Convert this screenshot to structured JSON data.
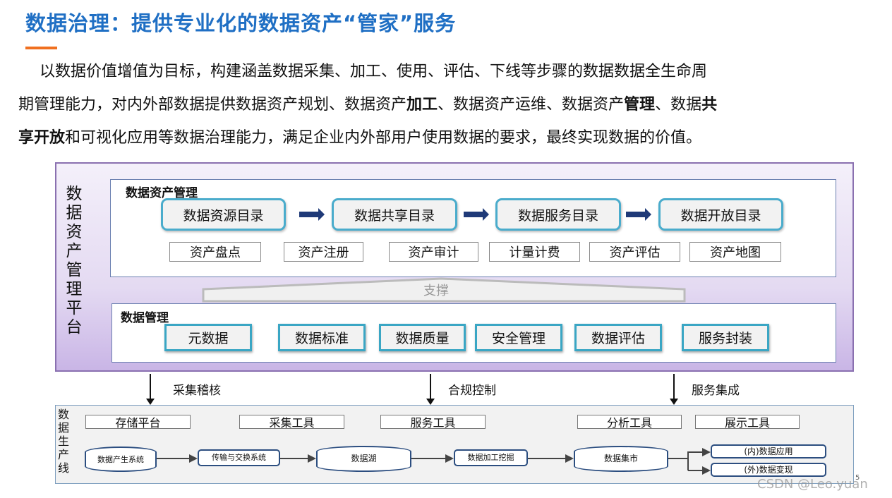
{
  "title": "数据治理：提供专业化的数据资产“管家”服务",
  "paragraph": {
    "line1": "以数据价值增值为目标，构建涵盖数据采集、加工、使用、评估、下线等步骤的数据数据全生命周",
    "line2a": "期管理能力，对内外部数据提供数据资产规划、数据资产",
    "b1": "加工",
    "line2b": "、数据资产运维、数据资产",
    "b2": "管理",
    "line2c": "、数据",
    "b3": "共",
    "b4": "享开放",
    "line3": "和可视化应用等数据治理能力，满足企业内外部用户使用数据的要求，最终实现数据的价值。"
  },
  "platform": {
    "label": "数据资产管理平台",
    "asset_mgmt": {
      "title": "数据资产管理",
      "catalogs": [
        "数据资源目录",
        "数据共享目录",
        "数据服务目录",
        "数据开放目录"
      ],
      "functions": [
        "资产盘点",
        "资产注册",
        "资产审计",
        "计量计费",
        "资产评估",
        "资产地图"
      ]
    },
    "support": "支撑",
    "data_mgmt": {
      "title": "数据管理",
      "items": [
        "元数据",
        "数据标准",
        "数据质量",
        "安全管理",
        "数据评估",
        "服务封装"
      ]
    }
  },
  "links": [
    "采集稽核",
    "合规控制",
    "服务集成"
  ],
  "production": {
    "label": "数据生产线",
    "tools": [
      "存储平台",
      "采集工具",
      "服务工具",
      "分析工具",
      "展示工具"
    ],
    "flow": [
      "数据产生系统",
      "传输与交换系统",
      "数据湖",
      "数据加工挖掘",
      "数据集市"
    ],
    "outputs": [
      "(内)数据应用",
      "(外)数据变现"
    ]
  },
  "page_number": "5",
  "watermark": "CSDN @Leo.yuan",
  "colors": {
    "title": "#1f6fc4",
    "accent": "#f07020",
    "teal": "#4aaccc",
    "platform_bg": "#c9b5e6"
  }
}
